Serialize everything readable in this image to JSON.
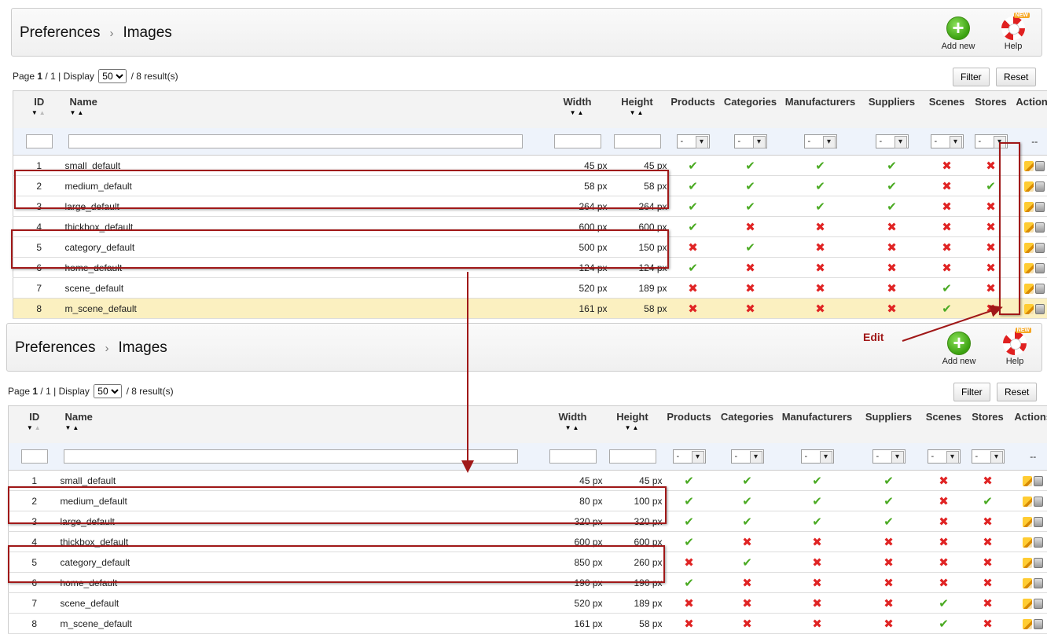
{
  "breadcrumb": {
    "parent": "Preferences",
    "separator": "›",
    "current": "Images"
  },
  "toolbar": {
    "add_label": "Add new",
    "help_label": "Help",
    "new_tag": "NEW"
  },
  "pager": {
    "page_label": "Page",
    "page": "1",
    "of": "1",
    "display_label": "Display",
    "per_page": "50",
    "results": "8 result(s)"
  },
  "buttons": {
    "filter": "Filter",
    "reset": "Reset"
  },
  "columns": {
    "id": "ID",
    "name": "Name",
    "width": "Width",
    "height": "Height",
    "products": "Products",
    "categories": "Categories",
    "manufacturers": "Manufacturers",
    "suppliers": "Suppliers",
    "scenes": "Scenes",
    "stores": "Stores",
    "actions": "Actions"
  },
  "filter_select": "-",
  "actions_placeholder": "--",
  "annotation": {
    "edit": "Edit"
  },
  "colors": {
    "highlight": "#fbf0c0",
    "annotation": "#a01818",
    "yes": "#4aaa22",
    "no": "#e02424"
  },
  "before": {
    "rows": [
      {
        "id": "1",
        "name": "small_default",
        "width": "45 px",
        "height": "45 px",
        "flags": [
          1,
          1,
          1,
          1,
          0,
          0
        ]
      },
      {
        "id": "2",
        "name": "medium_default",
        "width": "58 px",
        "height": "58 px",
        "flags": [
          1,
          1,
          1,
          1,
          0,
          1
        ]
      },
      {
        "id": "3",
        "name": "large_default",
        "width": "264 px",
        "height": "264 px",
        "flags": [
          1,
          1,
          1,
          1,
          0,
          0
        ]
      },
      {
        "id": "4",
        "name": "thickbox_default",
        "width": "600 px",
        "height": "600 px",
        "flags": [
          1,
          0,
          0,
          0,
          0,
          0
        ]
      },
      {
        "id": "5",
        "name": "category_default",
        "width": "500 px",
        "height": "150 px",
        "flags": [
          0,
          1,
          0,
          0,
          0,
          0
        ]
      },
      {
        "id": "6",
        "name": "home_default",
        "width": "124 px",
        "height": "124 px",
        "flags": [
          1,
          0,
          0,
          0,
          0,
          0
        ]
      },
      {
        "id": "7",
        "name": "scene_default",
        "width": "520 px",
        "height": "189 px",
        "flags": [
          0,
          0,
          0,
          0,
          1,
          0
        ]
      },
      {
        "id": "8",
        "name": "m_scene_default",
        "width": "161 px",
        "height": "58 px",
        "flags": [
          0,
          0,
          0,
          0,
          1,
          0
        ],
        "highlighted": true
      }
    ]
  },
  "after": {
    "rows": [
      {
        "id": "1",
        "name": "small_default",
        "width": "45 px",
        "height": "45 px",
        "flags": [
          1,
          1,
          1,
          1,
          0,
          0
        ]
      },
      {
        "id": "2",
        "name": "medium_default",
        "width": "80 px",
        "height": "100 px",
        "flags": [
          1,
          1,
          1,
          1,
          0,
          1
        ]
      },
      {
        "id": "3",
        "name": "large_default",
        "width": "320 px",
        "height": "320 px",
        "flags": [
          1,
          1,
          1,
          1,
          0,
          0
        ]
      },
      {
        "id": "4",
        "name": "thickbox_default",
        "width": "600 px",
        "height": "600 px",
        "flags": [
          1,
          0,
          0,
          0,
          0,
          0
        ]
      },
      {
        "id": "5",
        "name": "category_default",
        "width": "850 px",
        "height": "260 px",
        "flags": [
          0,
          1,
          0,
          0,
          0,
          0
        ]
      },
      {
        "id": "6",
        "name": "home_default",
        "width": "190 px",
        "height": "190 px",
        "flags": [
          1,
          0,
          0,
          0,
          0,
          0
        ]
      },
      {
        "id": "7",
        "name": "scene_default",
        "width": "520 px",
        "height": "189 px",
        "flags": [
          0,
          0,
          0,
          0,
          1,
          0
        ]
      },
      {
        "id": "8",
        "name": "m_scene_default",
        "width": "161 px",
        "height": "58 px",
        "flags": [
          0,
          0,
          0,
          0,
          1,
          0
        ]
      }
    ]
  }
}
